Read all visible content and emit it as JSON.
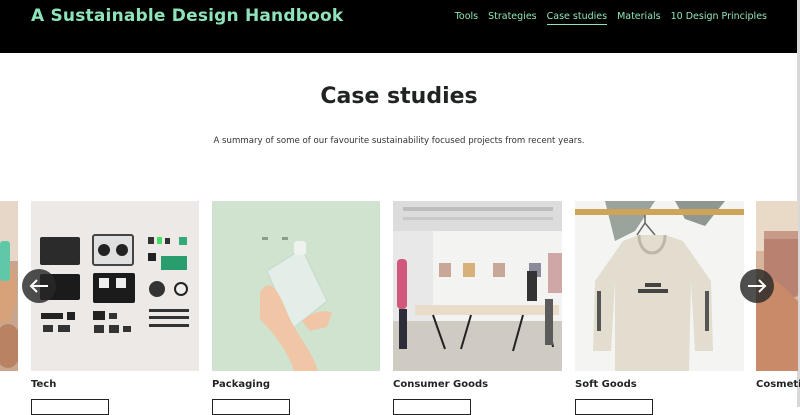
{
  "header": {
    "site_title": "A Sustainable Design Handbook",
    "nav": [
      {
        "label": "Tools"
      },
      {
        "label": "Strategies"
      },
      {
        "label": "Case studies",
        "active": true
      },
      {
        "label": "Materials"
      },
      {
        "label": "10 Design Principles"
      }
    ]
  },
  "main": {
    "title": "Case studies",
    "summary": "A summary of some of our favourite sustainability focused projects from recent years."
  },
  "carousel": {
    "cards": [
      {
        "label": "Tech"
      },
      {
        "label": "Packaging"
      },
      {
        "label": "Consumer Goods"
      },
      {
        "label": "Soft Goods"
      },
      {
        "label": "Cosmetic"
      }
    ],
    "prev_icon": "arrow-left-icon",
    "next_icon": "arrow-right-icon"
  },
  "colors": {
    "accent": "#8fe3ba",
    "header_bg": "#000000",
    "text": "#1f2421"
  }
}
